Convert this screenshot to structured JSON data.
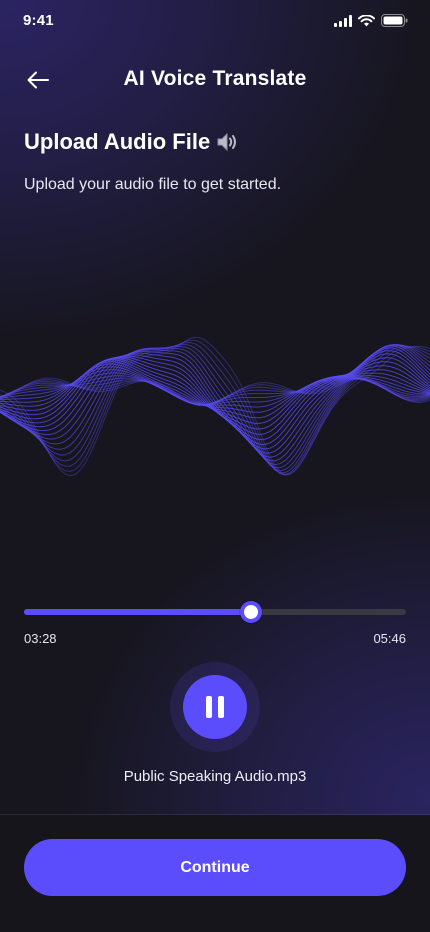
{
  "status_bar": {
    "time": "9:41",
    "icons": [
      "signal-icon",
      "wifi-icon",
      "battery-icon"
    ]
  },
  "header": {
    "back_icon": "arrow-left-icon",
    "title": "AI Voice Translate"
  },
  "section": {
    "title": "Upload Audio File",
    "title_icon": "speaker-icon",
    "subtitle": "Upload your audio file to get started."
  },
  "player": {
    "current_time": "03:28",
    "total_time": "05:46",
    "progress_fraction": 0.595,
    "play_state_icon": "pause-icon",
    "file_name": "Public Speaking Audio.mp3"
  },
  "actions": {
    "continue_label": "Continue"
  },
  "colors": {
    "accent": "#5b4dfb",
    "background": "#17161f",
    "track": "#3a3942"
  }
}
